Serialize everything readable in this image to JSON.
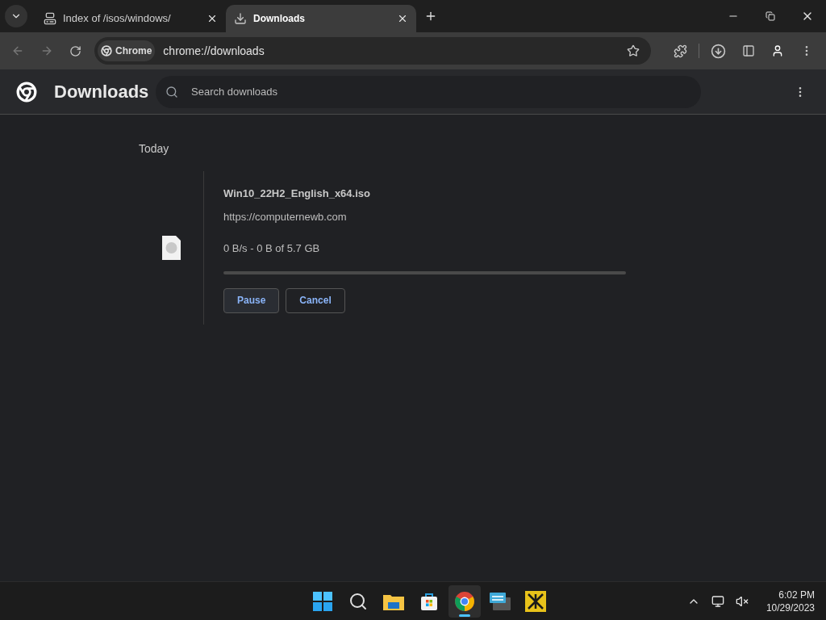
{
  "tabs": [
    {
      "title": "Index of /isos/windows/",
      "kind": "computer",
      "selected": false
    },
    {
      "title": "Downloads",
      "kind": "download",
      "selected": true
    }
  ],
  "address_bar": {
    "chip": "Chrome",
    "url": "chrome://downloads"
  },
  "page": {
    "title": "Downloads",
    "search": {
      "placeholder": "Search downloads"
    }
  },
  "groups": [
    {
      "date": "Today",
      "items": [
        {
          "filename": "Win10_22H2_English_x64.iso",
          "source": "https://computernewb.com",
          "status": "0 B/s - 0 B of 5.7 GB",
          "level": 0,
          "buttons": [
            {
              "label": "Pause",
              "primary": true
            },
            {
              "label": "Cancel",
              "primary": false
            }
          ]
        }
      ]
    }
  ],
  "taskbar": {
    "apps": [
      {
        "kind": "start",
        "selected": false
      },
      {
        "kind": "search",
        "selected": false
      },
      {
        "kind": "files",
        "selected": false
      },
      {
        "kind": "store",
        "selected": false
      },
      {
        "kind": "chrome",
        "selected": true
      },
      {
        "kind": "keyboard",
        "selected": false
      },
      {
        "kind": "network-tool",
        "selected": false
      }
    ],
    "time": "6:02 PM",
    "date": "10/29/2023"
  }
}
